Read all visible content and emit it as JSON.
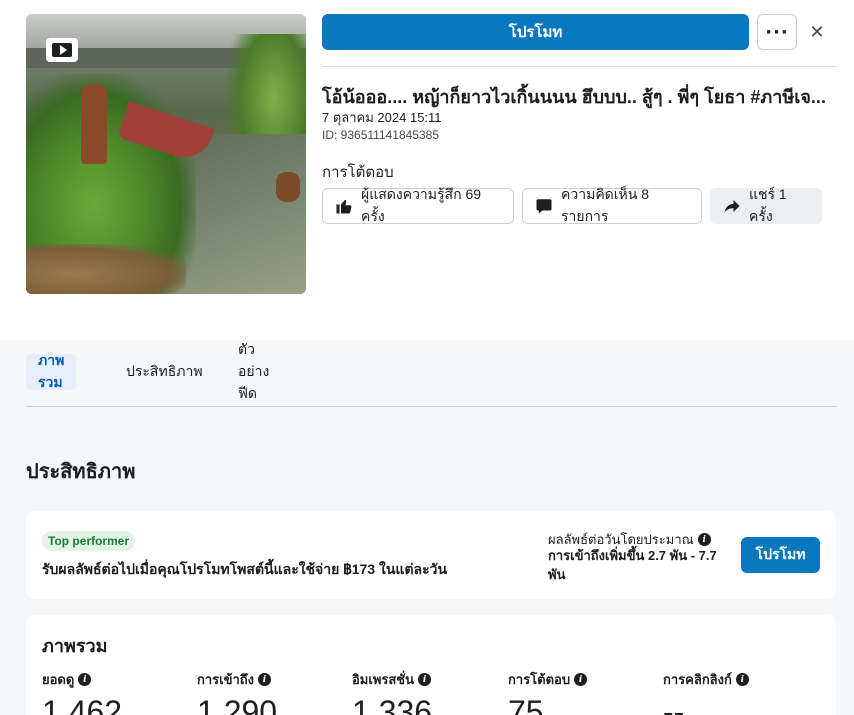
{
  "header": {
    "promote_label": "โปรโมท",
    "more_label": "···",
    "close_label": "✕"
  },
  "post": {
    "title": "โอ้น้อออ.... หญ้าก็ยาวไวเกิ้นนนน ฮึบบบ.. สู้ๆ . พี่ๆ โยธา #ภาษีเจ...",
    "date": "7 ตุลาคม 2024 15:11",
    "id": "ID: 936511141845385",
    "thumbnail_icon": "video-play-icon"
  },
  "reactions": {
    "label": "การโต้ตอบ",
    "reactions_pill": "ผู้แสดงความรู้สึก 69 ครั้ง",
    "comments_pill": "ความคิดเห็น 8 รายการ",
    "shares_pill": "แชร์ 1 ครั้ง"
  },
  "tabs": [
    {
      "label": "ภาพรวม",
      "active": true
    },
    {
      "label": "ประสิทธิภาพ",
      "active": false
    },
    {
      "label": "ตัวอย่างฟีด",
      "active": false
    }
  ],
  "performance": {
    "section_title": "ประสิทธิภาพ",
    "badge": "Top performer",
    "text": "รับผลลัพธ์ต่อไปเมื่อคุณโปรโมทโพสต์นี้และใช้จ่าย ฿173 ในแต่ละวัน",
    "estimate_label": "ผลลัพธ์ต่อวันโดยประมาณ",
    "estimate_value": "การเข้าถึงเพิ่มขึ้น 2.7 พัน - 7.7 พัน",
    "promote_label": "โปรโมท"
  },
  "overview": {
    "title": "ภาพรวม",
    "metrics": [
      {
        "label": "ยอดดู",
        "value": "1,462"
      },
      {
        "label": "การเข้าถึง",
        "value": "1,290"
      },
      {
        "label": "อิมเพรสชั่น",
        "value": "1,336"
      },
      {
        "label": "การโต้ตอบ",
        "value": "75"
      },
      {
        "label": "การคลิกลิงก์",
        "value": "--"
      }
    ]
  },
  "colors": {
    "primary": "#0a78be",
    "badge_bg": "#e3f4e6",
    "badge_text": "#1b7a36",
    "active_tab_bg": "#e7f0fa"
  }
}
